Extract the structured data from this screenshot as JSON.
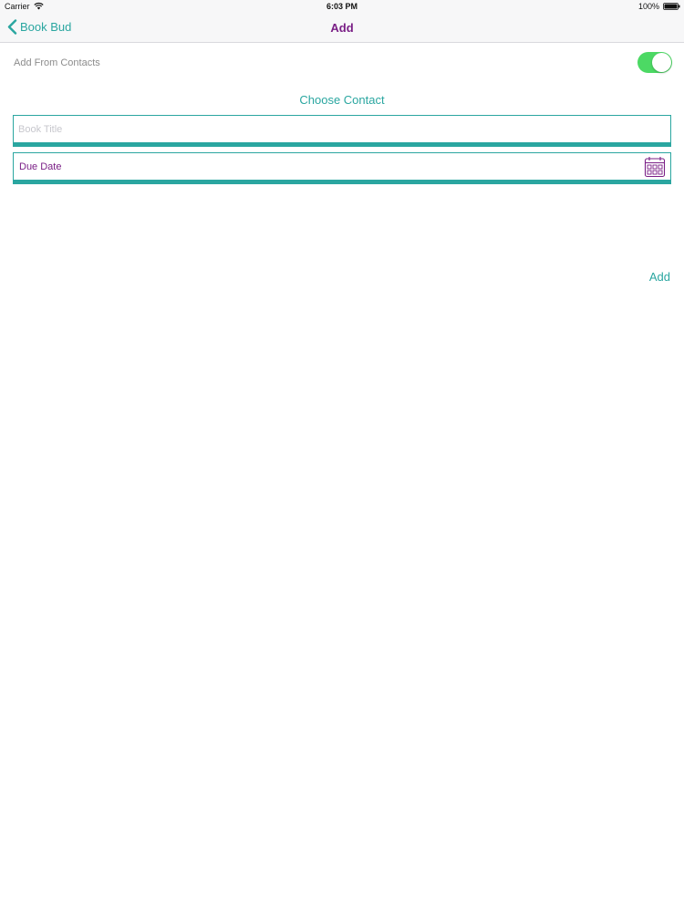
{
  "status_bar": {
    "carrier": "Carrier",
    "time": "6:03 PM",
    "battery": "100%"
  },
  "nav": {
    "back_label": "Book Bud",
    "title": "Add"
  },
  "form": {
    "add_from_contacts_label": "Add From Contacts",
    "add_from_contacts_on": true,
    "choose_contact_label": "Choose Contact",
    "book_title_placeholder": "Book Title",
    "book_title_value": "",
    "due_date_label": "Due Date",
    "submit_label": "Add"
  },
  "icons": {
    "back": "chevron-left-icon",
    "calendar": "calendar-icon",
    "wifi": "wifi-icon",
    "battery": "battery-icon"
  },
  "colors": {
    "accent": "#2aa6a0",
    "title": "#7a1f86",
    "toggle_on": "#4cd964",
    "muted_label": "#8c8c8c"
  }
}
